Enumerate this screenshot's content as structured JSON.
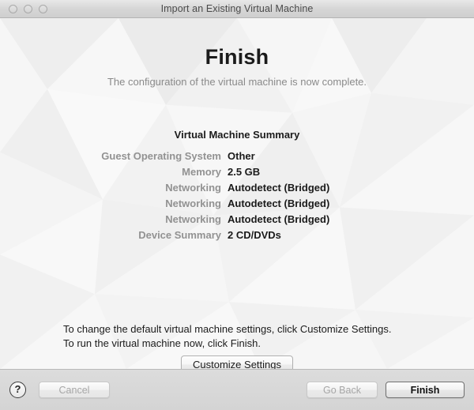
{
  "window": {
    "title": "Import an Existing Virtual Machine",
    "traffic_lights": [
      "close-button",
      "minimize-button",
      "zoom-button"
    ]
  },
  "page": {
    "heading": "Finish",
    "subheading": "The configuration of the virtual machine is now complete.",
    "summary_title": "Virtual Machine Summary",
    "summary_rows": [
      {
        "label": "Guest Operating System",
        "value": "Other"
      },
      {
        "label": "Memory",
        "value": "2.5 GB"
      },
      {
        "label": "Networking",
        "value": "Autodetect (Bridged)"
      },
      {
        "label": "Networking",
        "value": "Autodetect (Bridged)"
      },
      {
        "label": "Networking",
        "value": "Autodetect (Bridged)"
      },
      {
        "label": "Device Summary",
        "value": "2 CD/DVDs"
      }
    ],
    "instructions": [
      "To change the default virtual machine settings, click Customize Settings.",
      "To run the virtual machine now, click Finish."
    ],
    "customize_button": "Customize Settings"
  },
  "footer": {
    "help_label": "?",
    "cancel_label": "Cancel",
    "go_back_label": "Go Back",
    "finish_label": "Finish"
  },
  "colors": {
    "titlebar_text": "#4a4a4a",
    "heading": "#1b1b1b",
    "subheading": "#8a8a8a",
    "summary_label": "#929292",
    "summary_value": "#1b1b1b",
    "content_bg": "#f4f4f4",
    "footer_bg": "#d6d6d6"
  }
}
